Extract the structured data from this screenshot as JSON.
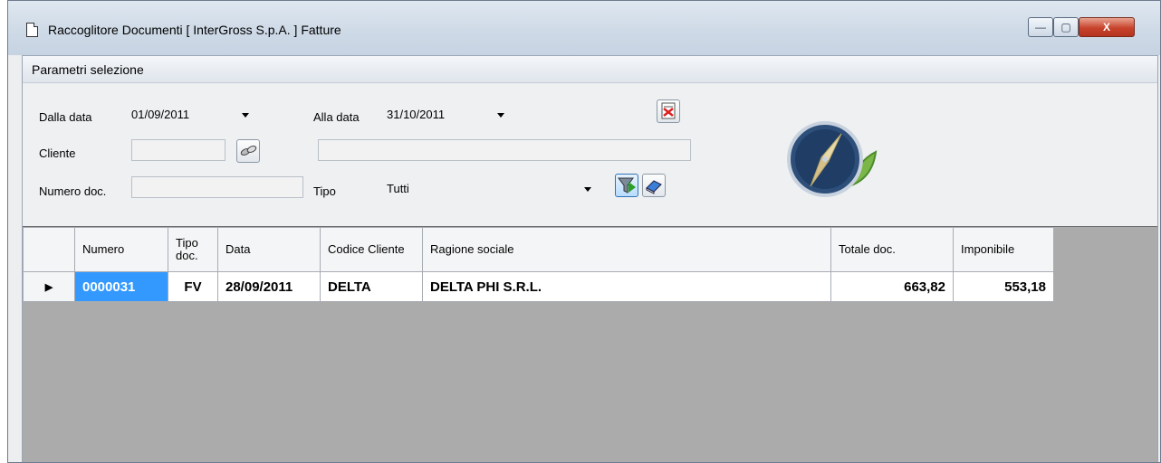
{
  "window": {
    "title": "Raccoglitore Documenti [ InterGross S.p.A. ] Fatture",
    "min_glyph": "—",
    "max_glyph": "▢",
    "close_glyph": "X"
  },
  "section": {
    "title": "Parametri selezione"
  },
  "filters": {
    "from_label": "Dalla data",
    "from_value": "01/09/2011",
    "to_label": "Alla data",
    "to_value": "31/10/2011",
    "client_label": "Cliente",
    "client_code": "",
    "client_name": "",
    "docnum_label": "Numero doc.",
    "docnum_value": "",
    "type_label": "Tipo",
    "type_value": "Tutti"
  },
  "grid": {
    "headers": [
      "Numero",
      "Tipo doc.",
      "Data",
      "Codice Cliente",
      "Ragione sociale",
      "Totale doc.",
      "Imponibile"
    ],
    "rows": [
      {
        "numero": "0000031",
        "tipo": "FV",
        "data": "28/09/2011",
        "codice": "DELTA",
        "ragione": "DELTA PHI S.R.L.",
        "totale": "663,82",
        "imponibile": "553,18"
      }
    ],
    "current_row_marker": "▶"
  },
  "colors": {
    "selection": "#3399ff",
    "grid_background": "#ababab",
    "title_bar": "#cdd9e6"
  }
}
